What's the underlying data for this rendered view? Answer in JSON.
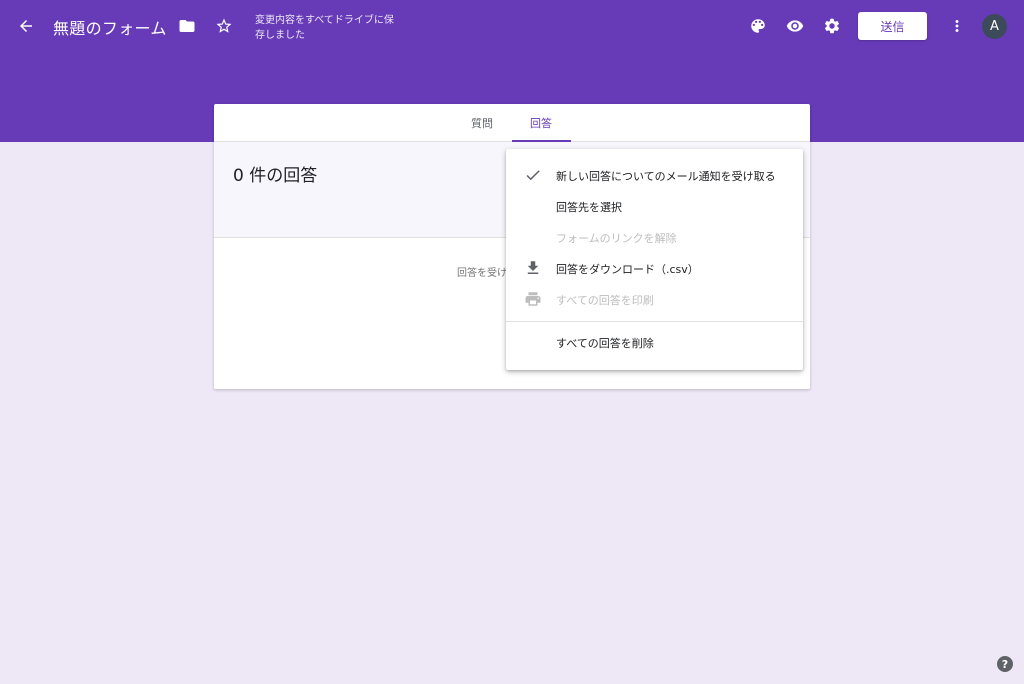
{
  "header": {
    "title": "無題のフォーム",
    "save_status": "変更内容をすべてドライブに保存しました",
    "send_label": "送信",
    "avatar_letter": "A",
    "icons": [
      "back-arrow-icon",
      "folder-icon",
      "star-icon",
      "palette-icon",
      "eye-icon",
      "gear-icon",
      "more-vert-icon"
    ]
  },
  "tabs": [
    {
      "label": "質問",
      "active": false
    },
    {
      "label": "回答",
      "active": true
    }
  ],
  "responses": {
    "count_text": "0 件の回答",
    "notice": "回答を受け"
  },
  "menu": {
    "items": [
      {
        "label": "新しい回答についてのメール通知を受け取る",
        "icon": "check-icon",
        "disabled": false
      },
      {
        "label": "回答先を選択",
        "icon": "",
        "disabled": false
      },
      {
        "label": "フォームのリンクを解除",
        "icon": "",
        "disabled": true
      },
      {
        "label": "回答をダウンロード（.csv）",
        "icon": "download-icon",
        "disabled": false
      },
      {
        "label": "すべての回答を印刷",
        "icon": "print-icon",
        "disabled": true
      },
      {
        "label": "すべての回答を削除",
        "icon": "",
        "disabled": false
      }
    ]
  },
  "help": {
    "label": "?"
  },
  "colors": {
    "brand": "#673ab7",
    "background": "#ede7f6"
  }
}
